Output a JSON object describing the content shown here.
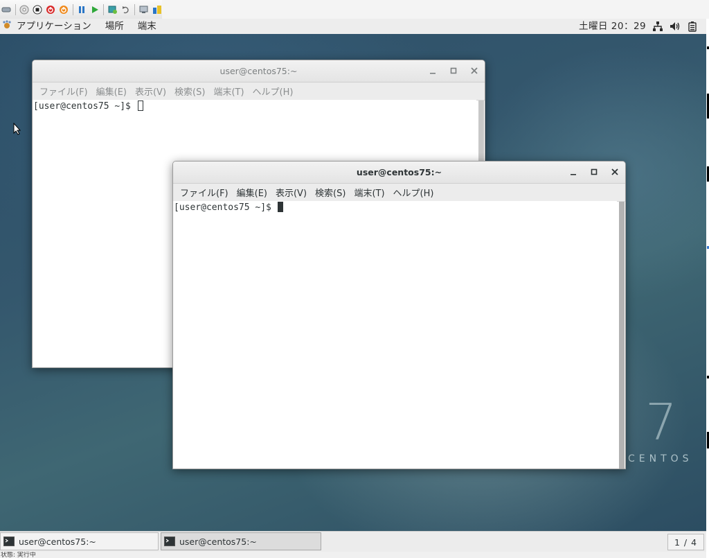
{
  "vm_toolbar": {
    "icons": [
      "network-icon",
      "cd-icon",
      "stop-icon",
      "power-off-icon",
      "power-icon",
      "pause-icon",
      "play-icon",
      "snapshot-icon",
      "revert-icon",
      "console-icon",
      "settings-icon"
    ]
  },
  "topbar": {
    "applications_label": "アプリケーション",
    "places_label": "場所",
    "terminal_label": "端末",
    "clock": "土曜日 20：29",
    "system_icons": [
      "network-icon",
      "volume-icon",
      "battery-icon"
    ]
  },
  "desktop": {
    "brand_number": "7",
    "brand_text": "CENTOS"
  },
  "window_back": {
    "title": "user@centos75:~",
    "menu": [
      "ファイル(F)",
      "編集(E)",
      "表示(V)",
      "検索(S)",
      "端末(T)",
      "ヘルプ(H)"
    ],
    "prompt": "[user@centos75 ~]$ "
  },
  "window_front": {
    "title": "user@centos75:~",
    "menu": [
      "ファイル(F)",
      "編集(E)",
      "表示(V)",
      "検索(S)",
      "端末(T)",
      "ヘルプ(H)"
    ],
    "prompt": "[user@centos75 ~]$ "
  },
  "taskbar": {
    "tasks": [
      {
        "label": "user@centos75:~"
      },
      {
        "label": "user@centos75:~"
      }
    ],
    "workspace": "1 / 4"
  },
  "statusbar": {
    "text": "状態: 実行中"
  },
  "colors": {
    "desktop": "#34576d",
    "panel": "#ededed",
    "window_bg": "#ffffff"
  }
}
